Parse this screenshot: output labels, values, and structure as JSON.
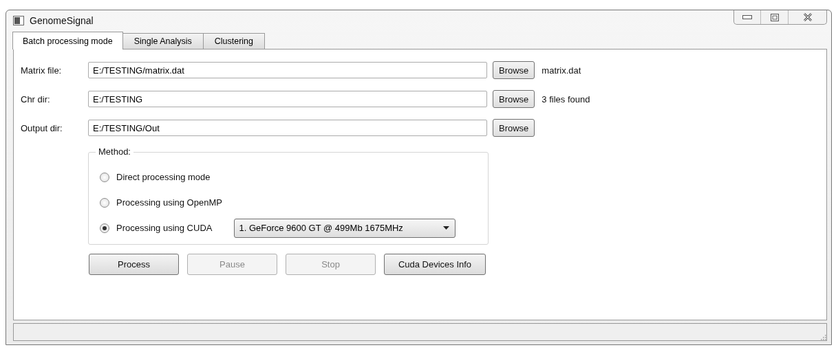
{
  "window": {
    "title": "GenomeSignal"
  },
  "tabs": [
    {
      "label": "Batch processing mode",
      "selected": true
    },
    {
      "label": "Single Analysis",
      "selected": false
    },
    {
      "label": "Clustering",
      "selected": false
    }
  ],
  "paths": [
    {
      "label": "Matrix file:",
      "value": "E:/TESTING/matrix.dat",
      "button": "Browse",
      "status": "matrix.dat"
    },
    {
      "label": "Chr dir:",
      "value": "E:/TESTING",
      "button": "Browse",
      "status": "3 files found"
    },
    {
      "label": "Output dir:",
      "value": "E:/TESTING/Out",
      "button": "Browse"
    }
  ],
  "method": {
    "title": "Method:",
    "options": [
      {
        "label": "Direct processing mode",
        "selected": false
      },
      {
        "label": "Processing using OpenMP",
        "selected": false
      },
      {
        "label": "Processing using CUDA",
        "selected": true,
        "device": "1. GeForce 9600 GT @ 499Mb 1675MHz"
      }
    ]
  },
  "actions": [
    {
      "label": "Process",
      "disabled": false
    },
    {
      "label": "Pause",
      "disabled": true
    },
    {
      "label": "Stop",
      "disabled": true
    },
    {
      "label": "Cuda Devices Info",
      "disabled": false
    }
  ]
}
